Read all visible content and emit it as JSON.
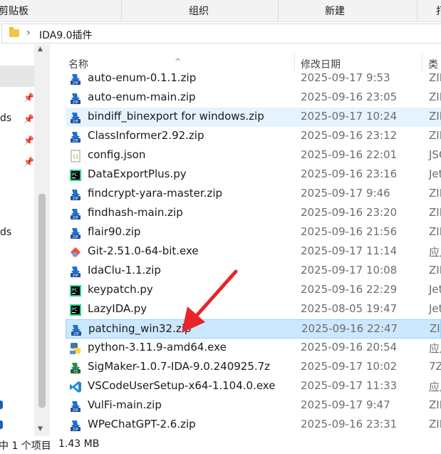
{
  "ribbon": {
    "clipboard": "剪贴板",
    "organize": "组织",
    "new": "新建",
    "cut_off": "打"
  },
  "address": {
    "path": "IDA9.0插件"
  },
  "nav": {
    "item_a": "ds",
    "item_b": "ds"
  },
  "columns": {
    "name": "名称",
    "modified": "修改日期",
    "type": "类"
  },
  "files": [
    {
      "name": "auto-enum-0.1.1.zip",
      "date": "2025-09-17 9:53",
      "type": "ZIP",
      "icon": "zip-archive-icon"
    },
    {
      "name": "auto-enum-main.zip",
      "date": "2025-09-16 23:05",
      "type": "ZIP",
      "icon": "zip-archive-icon"
    },
    {
      "name": "bindiff_binexport for windows.zip",
      "date": "2025-09-17 10:24",
      "type": "ZIP",
      "icon": "zip-archive-icon"
    },
    {
      "name": "ClassInformer2.92.zip",
      "date": "2025-09-16 23:12",
      "type": "ZIP",
      "icon": "zip-archive-icon"
    },
    {
      "name": "config.json",
      "date": "2025-09-16 22:01",
      "type": "JSO",
      "icon": "json-file-icon"
    },
    {
      "name": "DataExportPlus.py",
      "date": "2025-09-16 23:16",
      "type": "Jet",
      "icon": "pycharm-file-icon"
    },
    {
      "name": "findcrypt-yara-master.zip",
      "date": "2025-09-17 9:46",
      "type": "ZIP",
      "icon": "zip-archive-icon"
    },
    {
      "name": "findhash-main.zip",
      "date": "2025-09-16 23:20",
      "type": "ZIP",
      "icon": "zip-archive-icon"
    },
    {
      "name": "flair90.zip",
      "date": "2025-09-16 21:56",
      "type": "ZIP",
      "icon": "zip-archive-icon"
    },
    {
      "name": "Git-2.51.0-64-bit.exe",
      "date": "2025-09-17 11:14",
      "type": "应用",
      "icon": "git-installer-icon"
    },
    {
      "name": "IdaClu-1.1.zip",
      "date": "2025-09-17 10:08",
      "type": "ZIP",
      "icon": "zip-archive-icon"
    },
    {
      "name": "keypatch.py",
      "date": "2025-09-16 22:29",
      "type": "Jet",
      "icon": "pycharm-file-icon"
    },
    {
      "name": "LazyIDA.py",
      "date": "2025-08-05 19:47",
      "type": "Jet",
      "icon": "pycharm-file-icon"
    },
    {
      "name": "patching_win32.zip",
      "date": "2025-09-16 22:47",
      "type": "ZIP",
      "icon": "zip-archive-icon"
    },
    {
      "name": "python-3.11.9-amd64.exe",
      "date": "2025-09-16 20:54",
      "type": "应用",
      "icon": "python-installer-icon"
    },
    {
      "name": "SigMaker-1.0.7-IDA-9.0.240925.7z",
      "date": "2025-09-17 10:02",
      "type": "7Z",
      "icon": "7z-archive-icon"
    },
    {
      "name": "VSCodeUserSetup-x64-1.104.0.exe",
      "date": "2025-09-17 11:33",
      "type": "应用",
      "icon": "vscode-installer-icon"
    },
    {
      "name": "VulFi-main.zip",
      "date": "2025-09-17 9:47",
      "type": "ZIP",
      "icon": "zip-archive-icon"
    },
    {
      "name": "WPeChatGPT-2.6.zip",
      "date": "2025-09-16 23:31",
      "type": "ZIP",
      "icon": "zip-archive-icon"
    }
  ],
  "selected_index": 13,
  "hover_index": 2,
  "status": {
    "selection": "中 1 个项目",
    "size": "1.43 MB"
  },
  "colors": {
    "selection_bg": "#cce8ff",
    "hover_bg": "#e5f3ff",
    "arrow": "#e8252a",
    "date_text": "#6d6d6d"
  }
}
